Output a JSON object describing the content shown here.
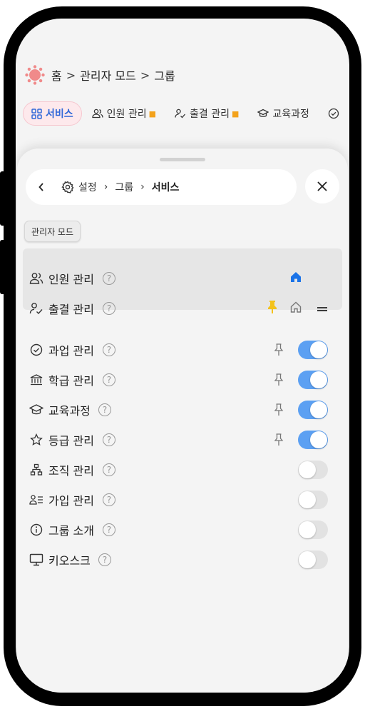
{
  "breadcrumb": {
    "home": "홈",
    "sep": ">",
    "admin": "관리자 모드",
    "current": "그룹"
  },
  "tabs": [
    {
      "label": "서비스",
      "active": true
    },
    {
      "label": "인원 관리",
      "pinned": true
    },
    {
      "label": "출결 관리",
      "pinned": true
    },
    {
      "label": "교육과정"
    }
  ],
  "sheet": {
    "nav": {
      "settings": "설정",
      "group": "그룹",
      "current": "서비스"
    },
    "admin_chip": "관리자 모드",
    "pinned_services": [
      {
        "label": "인원 관리",
        "icon": "people-icon",
        "home": true
      },
      {
        "label": "출결 관리",
        "icon": "attendance-icon",
        "pinned": true
      }
    ],
    "services": [
      {
        "label": "과업 관리",
        "icon": "check-circle-icon",
        "enabled": true
      },
      {
        "label": "학급 관리",
        "icon": "bank-icon",
        "enabled": true
      },
      {
        "label": "교육과정",
        "icon": "graduation-cap-icon",
        "enabled": true
      },
      {
        "label": "등급 관리",
        "icon": "star-icon",
        "enabled": true
      },
      {
        "label": "조직 관리",
        "icon": "org-chart-icon",
        "enabled": false
      },
      {
        "label": "가입 관리",
        "icon": "user-list-icon",
        "enabled": false
      },
      {
        "label": "그룹 소개",
        "icon": "info-icon",
        "enabled": false
      },
      {
        "label": "키오스크",
        "icon": "monitor-icon",
        "enabled": false
      }
    ],
    "help_symbol": "?"
  },
  "colors": {
    "accent": "#2f68d8",
    "toggle_on": "#5ca0f2",
    "pin": "#f3c21b",
    "home": "#1a73e8"
  }
}
